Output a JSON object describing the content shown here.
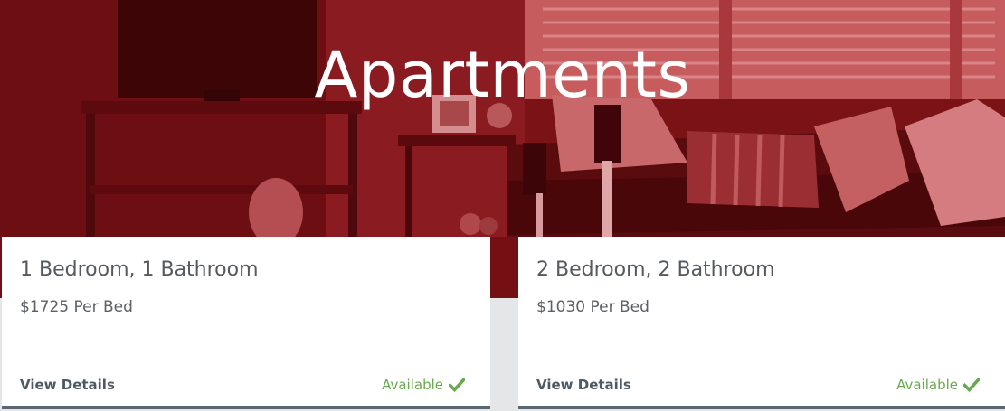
{
  "hero": {
    "title": "Apartments"
  },
  "cards": [
    {
      "title": "1 Bedroom, 1 Bathroom",
      "price": "$1725 Per Bed",
      "link_label": "View Details",
      "status": "Available",
      "status_icon": "checkmark-icon"
    },
    {
      "title": "2 Bedroom, 2 Bathroom",
      "price": "$1030 Per Bed",
      "link_label": "View Details",
      "status": "Available",
      "status_icon": "checkmark-icon"
    }
  ],
  "colors": {
    "hero_tint": "#7b1317",
    "status_green": "#69a84f",
    "card_border": "#5a6873",
    "page_bg": "#e4e6e8"
  }
}
